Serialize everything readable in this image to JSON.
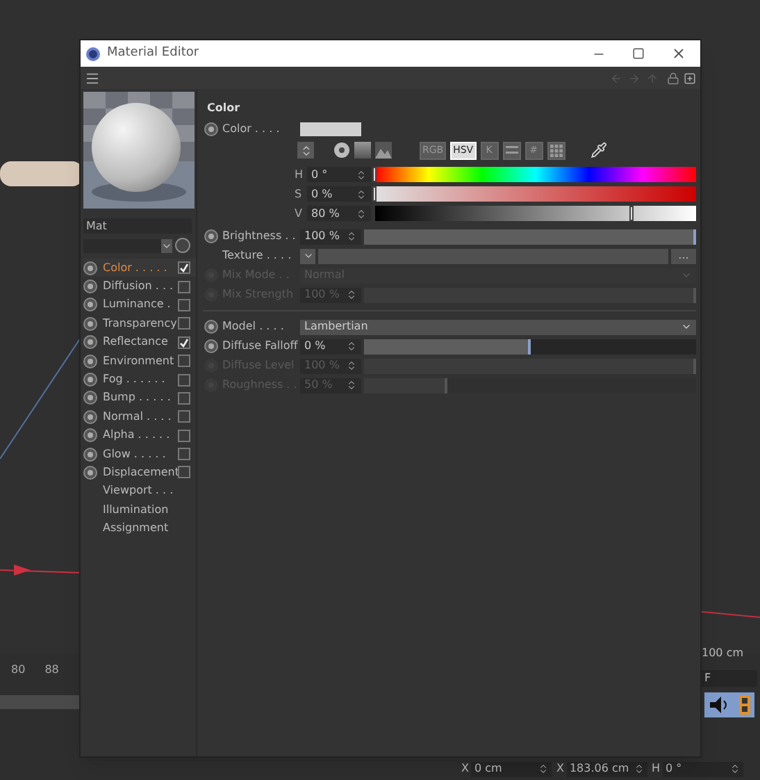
{
  "background": {
    "timeline_ticks": [
      "80",
      "88"
    ],
    "distance_label": "100 cm",
    "frame_field": "F",
    "coordinates": [
      {
        "axis": "X",
        "value": "0 cm"
      },
      {
        "axis": "X",
        "value": "183.06 cm"
      },
      {
        "axis": "H",
        "value": "0 °"
      }
    ]
  },
  "window": {
    "title": "Material Editor"
  },
  "material": {
    "name": "Mat"
  },
  "channels": [
    {
      "label": "Color . . . . .",
      "kind": "channel",
      "selected": true,
      "checked": true
    },
    {
      "label": "Diffusion . . .",
      "kind": "channel",
      "selected": false,
      "checked": false
    },
    {
      "label": "Luminance .",
      "kind": "channel",
      "selected": false,
      "checked": false
    },
    {
      "label": "Transparency",
      "kind": "channel",
      "selected": false,
      "checked": false
    },
    {
      "label": "Reflectance",
      "kind": "channel",
      "selected": false,
      "checked": true
    },
    {
      "label": "Environment",
      "kind": "channel",
      "selected": false,
      "checked": false
    },
    {
      "label": "Fog . . . . . .",
      "kind": "channel",
      "selected": false,
      "checked": false
    },
    {
      "label": "Bump . . . . .",
      "kind": "channel",
      "selected": false,
      "checked": false
    },
    {
      "label": "Normal . . . .",
      "kind": "channel",
      "selected": false,
      "checked": false
    },
    {
      "label": "Alpha . . . . .",
      "kind": "channel",
      "selected": false,
      "checked": false
    },
    {
      "label": "Glow . . . . .",
      "kind": "channel",
      "selected": false,
      "checked": false
    },
    {
      "label": "Displacement",
      "kind": "channel",
      "selected": false,
      "checked": false
    },
    {
      "label": "Viewport . . .",
      "kind": "plain",
      "selected": false
    },
    {
      "label": "Illumination",
      "kind": "plain",
      "selected": false
    },
    {
      "label": "Assignment",
      "kind": "plain",
      "selected": false
    }
  ],
  "section_title": "Color",
  "color": {
    "label": "Color . . . .",
    "modes": [
      {
        "kind": "text",
        "label": "RGB",
        "selected": false
      },
      {
        "kind": "text",
        "label": "HSV",
        "selected": true
      },
      {
        "kind": "text",
        "label": "K",
        "selected": false
      },
      {
        "kind": "sliders",
        "selected": false
      },
      {
        "kind": "text",
        "label": "#",
        "selected": false
      },
      {
        "kind": "grid",
        "selected": false
      }
    ],
    "hsv": [
      {
        "label": "H",
        "value": "0 °",
        "kind": "hue",
        "level": 0
      },
      {
        "label": "S",
        "value": "0 %",
        "kind": "saturation",
        "level": 0
      },
      {
        "label": "V",
        "value": "80 %",
        "kind": "value",
        "level": 0.8
      }
    ]
  },
  "params": [
    {
      "kind": "slider",
      "label": "Brightness . .",
      "value": "100 %",
      "level": 1,
      "disabled": false
    },
    {
      "kind": "texture",
      "label": "Texture . . . .",
      "button": "...",
      "disabled": false
    },
    {
      "kind": "dropdown",
      "label": "Mix Mode . .",
      "value": "Normal",
      "disabled": true
    },
    {
      "kind": "slider",
      "label": "Mix Strength",
      "value": "100 %",
      "level": 1,
      "disabled": true
    },
    {
      "kind": "divider"
    },
    {
      "kind": "dropdown",
      "label": "Model . . . .",
      "value": "Lambertian",
      "disabled": false
    },
    {
      "kind": "slider",
      "label": "Diffuse Falloff",
      "value": "0 %",
      "level": 0.5,
      "disabled": false
    },
    {
      "kind": "slider",
      "label": "Diffuse Level",
      "value": "100 %",
      "level": 1,
      "disabled": true
    },
    {
      "kind": "slider",
      "label": "Roughness . .",
      "value": "50 %",
      "level": 0.25,
      "disabled": true
    }
  ]
}
